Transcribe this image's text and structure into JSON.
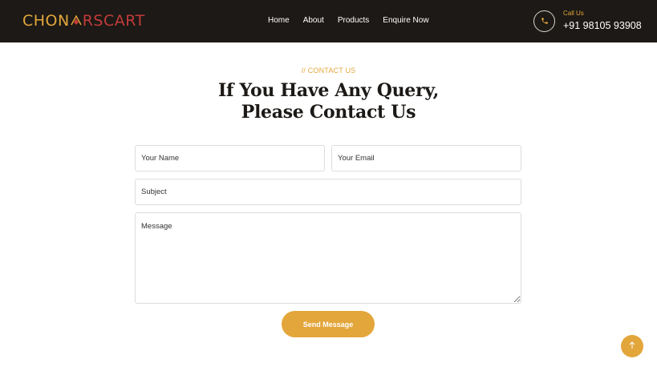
{
  "brand": {
    "logo_part_a": "CHON",
    "logo_part_b": "RSCART",
    "gold": "#e3a63b",
    "red": "#c23b3a",
    "dark": "#1c1916"
  },
  "nav": {
    "items": [
      "Home",
      "About",
      "Products",
      "Enquire Now"
    ]
  },
  "contact": {
    "label": "Call Us",
    "phone": "+91 98105 93908",
    "icon": "phone-icon"
  },
  "section": {
    "eyebrow": "// CONTACT US",
    "heading_line1": "If You Have Any Query,",
    "heading_line2": "Please Contact Us"
  },
  "form": {
    "name_placeholder": "Your Name",
    "email_placeholder": "Your Email",
    "subject_placeholder": "Subject",
    "message_placeholder": "Message",
    "submit_label": "Send Message"
  },
  "scroll_top": {
    "icon": "arrow-up-icon"
  }
}
